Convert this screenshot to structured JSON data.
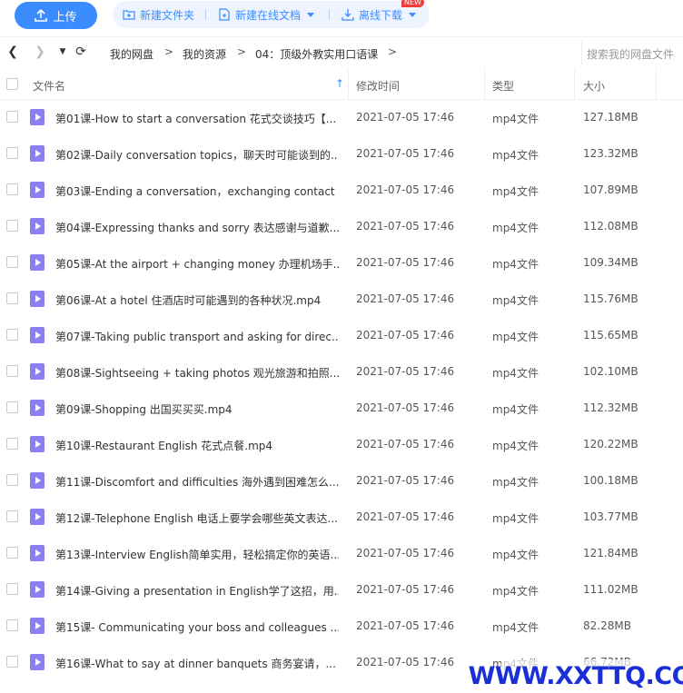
{
  "toolbar": {
    "upload_label": "上传",
    "new_folder_label": "新建文件夹",
    "new_online_doc_label": "新建在线文档",
    "new_badge": "NEW",
    "offline_download_label": "离线下载"
  },
  "nav": {
    "breadcrumb": [
      "我的网盘",
      "我的资源",
      "04：顶级外教实用口语课"
    ],
    "separator": ">",
    "search_placeholder": "搜索我的网盘文件"
  },
  "table": {
    "headers": {
      "name": "文件名",
      "modified": "修改时间",
      "type": "类型",
      "size": "大小"
    },
    "rows": [
      {
        "name": "第01课-How to start a conversation 花式交谈技巧【...",
        "modified": "2021-07-05 17:46",
        "type": "mp4文件",
        "size": "127.18MB"
      },
      {
        "name": "第02课-Daily conversation topics，聊天时可能谈到的...",
        "modified": "2021-07-05 17:46",
        "type": "mp4文件",
        "size": "123.32MB"
      },
      {
        "name": "第03课-Ending a conversation，exchanging contact ...",
        "modified": "2021-07-05 17:46",
        "type": "mp4文件",
        "size": "107.89MB"
      },
      {
        "name": "第04课-Expressing thanks and sorry 表达感谢与道歉...",
        "modified": "2021-07-05 17:46",
        "type": "mp4文件",
        "size": "112.08MB"
      },
      {
        "name": "第05课-At the airport + changing money 办理机场手...",
        "modified": "2021-07-05 17:46",
        "type": "mp4文件",
        "size": "109.34MB"
      },
      {
        "name": "第06课-At a hotel 住酒店时可能遇到的各种状况.mp4",
        "modified": "2021-07-05 17:46",
        "type": "mp4文件",
        "size": "115.76MB"
      },
      {
        "name": "第07课-Taking public transport and asking for direc...",
        "modified": "2021-07-05 17:46",
        "type": "mp4文件",
        "size": "115.65MB"
      },
      {
        "name": "第08课-Sightseeing + taking photos 观光旅游和拍照...",
        "modified": "2021-07-05 17:46",
        "type": "mp4文件",
        "size": "102.10MB"
      },
      {
        "name": "第09课-Shopping 出国买买买.mp4",
        "modified": "2021-07-05 17:46",
        "type": "mp4文件",
        "size": "112.32MB"
      },
      {
        "name": "第10课-Restaurant English 花式点餐.mp4",
        "modified": "2021-07-05 17:46",
        "type": "mp4文件",
        "size": "120.22MB"
      },
      {
        "name": "第11课-Discomfort and difficulties 海外遇到困难怎么...",
        "modified": "2021-07-05 17:46",
        "type": "mp4文件",
        "size": "100.18MB"
      },
      {
        "name": "第12课-Telephone English 电话上要学会哪些英文表达...",
        "modified": "2021-07-05 17:46",
        "type": "mp4文件",
        "size": "103.77MB"
      },
      {
        "name": "第13课-Interview English简单实用，轻松搞定你的英语...",
        "modified": "2021-07-05 17:46",
        "type": "mp4文件",
        "size": "121.84MB"
      },
      {
        "name": "第14课-Giving a presentation in English学了这招，用...",
        "modified": "2021-07-05 17:46",
        "type": "mp4文件",
        "size": "111.02MB"
      },
      {
        "name": "第15课- Communicating your boss and colleagues ...",
        "modified": "2021-07-05 17:46",
        "type": "mp4文件",
        "size": "82.28MB"
      },
      {
        "name": "第16课-What to say at dinner banquets 商务宴请，...",
        "modified": "2021-07-05 17:46",
        "type": "mp4文件",
        "size": "66.72MB"
      }
    ]
  },
  "watermark": "WWW.XXTTQ.COM",
  "colors": {
    "accent": "#3b8cff",
    "video_icon": "#8a7ff0",
    "watermark": "#1a2fd6"
  }
}
